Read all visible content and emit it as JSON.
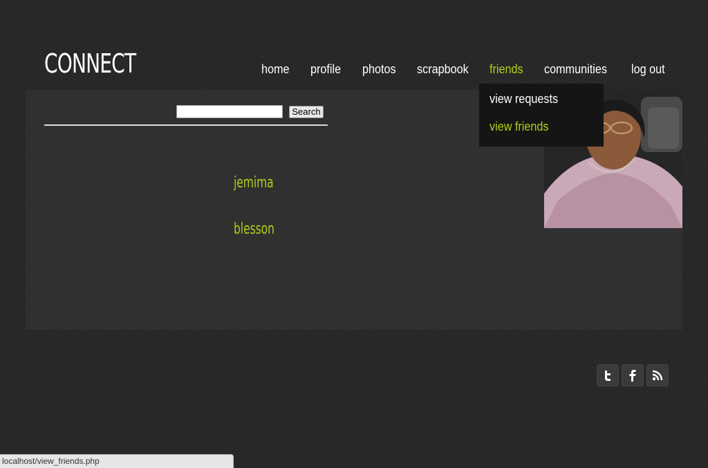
{
  "header": {
    "logo": "CONNECT"
  },
  "nav": {
    "items": [
      {
        "label": "home"
      },
      {
        "label": "profile"
      },
      {
        "label": "photos"
      },
      {
        "label": "scrapbook"
      },
      {
        "label": "friends",
        "active": true
      },
      {
        "label": "communities"
      },
      {
        "label": "log out"
      }
    ],
    "dropdown": {
      "items": [
        {
          "label": "view requests"
        },
        {
          "label": "view friends",
          "active": true
        }
      ]
    }
  },
  "search": {
    "value": "",
    "button_label": "Search"
  },
  "friends": [
    {
      "name": "jemima"
    },
    {
      "name": "blesson"
    }
  ],
  "social": [
    "twitter-icon",
    "facebook-icon",
    "rss-icon"
  ],
  "status_bar": {
    "url": "localhost/view_friends.php"
  },
  "colors": {
    "accent": "#b5cc18",
    "panel": "#303030",
    "background": "#262626",
    "dropdown": "#151515"
  }
}
